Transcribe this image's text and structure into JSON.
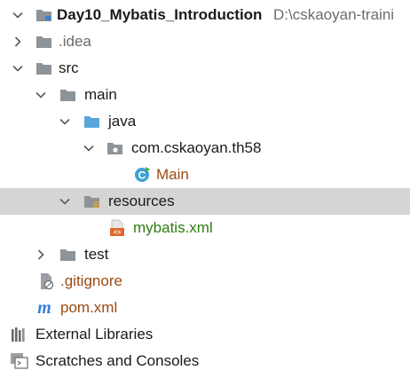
{
  "project": {
    "name": "Day10_Mybatis_Introduction",
    "path": "D:\\cskaoyan-traini"
  },
  "tree": {
    "idea": ".idea",
    "src": "src",
    "main": "main",
    "java": "java",
    "package": "com.cskaoyan.th58",
    "main_class": "Main",
    "resources": "resources",
    "mybatis_xml": "mybatis.xml",
    "test": "test",
    "gitignore": ".gitignore",
    "pom_xml": "pom.xml",
    "external_libraries": "External Libraries",
    "scratches": "Scratches and Consoles"
  },
  "colors": {
    "selection": "#d5d5d5",
    "folder": "#8c9399",
    "source_folder": "#5aa6da",
    "class_badge": "#3fa2d6",
    "xml_icon": "#e0662d",
    "green_text": "#2e7d13",
    "brown_text": "#9c4a12",
    "maven_m": "#3a7fd6"
  }
}
